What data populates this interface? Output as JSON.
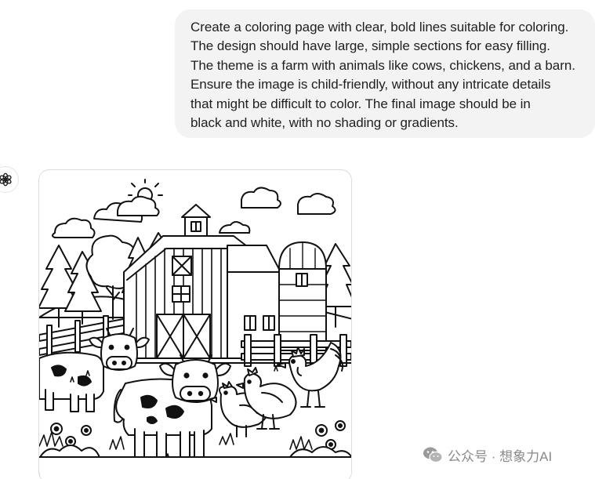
{
  "user_message": {
    "lines": [
      "Create a coloring page with clear, bold lines suitable for coloring.",
      "The design should have large, simple sections for easy filling.",
      "The theme is a farm with animals like cows, chickens, and a barn.",
      "Ensure the image is child-friendly, without any intricate details",
      "that might be difficult to color. The final image should be in",
      "black and white, with no shading or gradients."
    ]
  },
  "assistant": {
    "avatar_icon": "openai-logo-icon",
    "image": {
      "subject": "farm-coloring-page"
    }
  },
  "watermark": {
    "text": "公众号 · 想象力AI",
    "icon": "wechat-icon"
  }
}
